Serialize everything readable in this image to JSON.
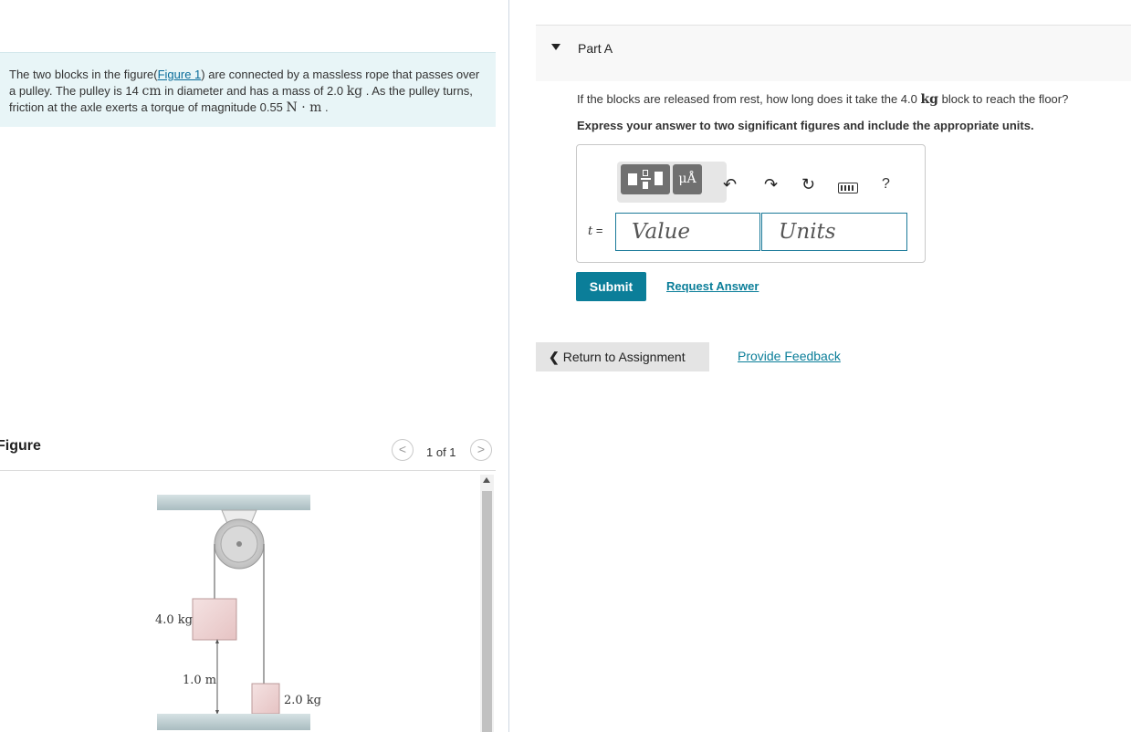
{
  "problem": {
    "text_before_link": "The two blocks in the figure(",
    "figure_link": "Figure 1",
    "text_after_link": ") are connected by a massless rope that passes over a pulley. The pulley is 14 ",
    "unit_cm": "cm",
    "text_2": " in diameter and has a mass of 2.0 ",
    "unit_kg": "kg",
    "text_3": " . As the pulley turns, friction at the axle exerts a torque of magnitude 0.55 ",
    "unit_nm": "N · m",
    "text_4": " ."
  },
  "figure": {
    "title": "Figure",
    "counter": "1 of 1",
    "prev": "<",
    "next": ">",
    "label_block1": "4.0 kg",
    "label_height": "1.0 m",
    "label_block2": "2.0 kg"
  },
  "part": {
    "title": "Part A",
    "question_before": "If the blocks are released from rest, how long does it take the 4.0 ",
    "question_unit": "kg",
    "question_after": " block to reach the floor?",
    "instruction": "Express your answer to two significant figures and include the appropriate units."
  },
  "toolbar": {
    "units_label": "μÅ",
    "undo": "↶",
    "redo": "↷",
    "reset": "↻",
    "help": "?"
  },
  "answer": {
    "variable": "t",
    "equals": " =",
    "value_placeholder": "Value",
    "units_placeholder": "Units"
  },
  "actions": {
    "submit": "Submit",
    "request_answer": "Request Answer",
    "return": "Return to Assignment",
    "feedback": "Provide Feedback"
  }
}
